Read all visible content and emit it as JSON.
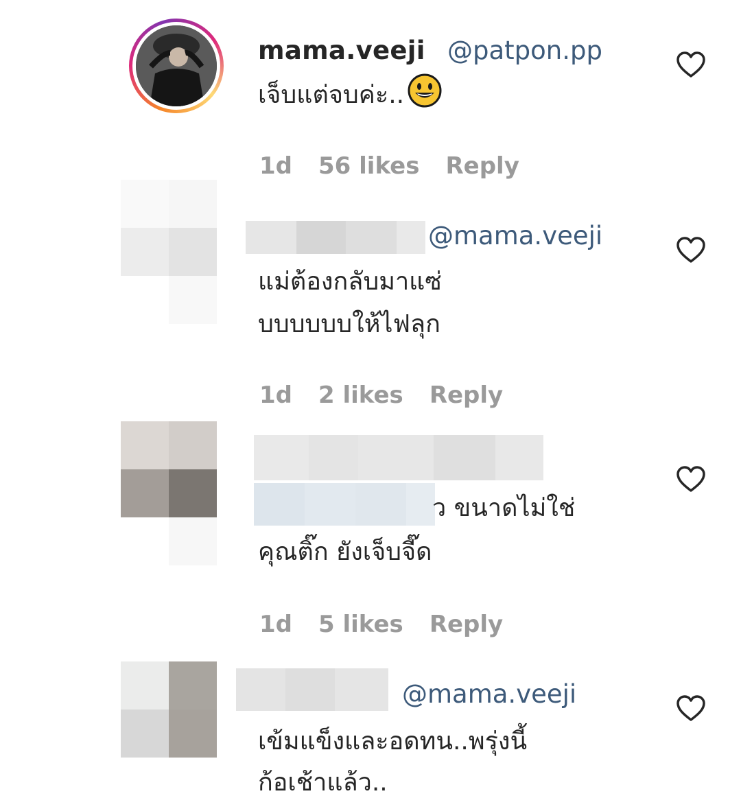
{
  "comments": [
    {
      "username": "mama.veeji",
      "mention": "@patpon.pp",
      "text_lines": [
        "เจ็บแต่จบค่ะ.."
      ],
      "emoji": "grinning-face-emoji",
      "time": "1d",
      "likes": "56 likes",
      "reply": "Reply"
    },
    {
      "username": "",
      "mention": "@mama.veeji",
      "text_lines": [
        "แม่ต้องกลับมาแซ่",
        "บบบบบบให้ไฟลุก"
      ],
      "time": "1d",
      "likes": "2 likes",
      "reply": "Reply"
    },
    {
      "username": "",
      "mention": "",
      "text_lines": [
        "ว ขนาดไม่ใช่",
        "คุณติ๊ก ยังเจ็บจี๊ด"
      ],
      "time": "1d",
      "likes": "5 likes",
      "reply": "Reply"
    },
    {
      "username": "",
      "mention": "@mama.veeji",
      "text_lines": [
        "เข้มแข็งและอดทน..พรุ่งนี้",
        "ก้อเช้าแล้ว.."
      ]
    }
  ],
  "icons": {
    "like": "heart-outline-icon",
    "avatar_ring": "story-ring"
  },
  "colors": {
    "mention": "#3d5a7a",
    "meta": "#9a9a9a",
    "text": "#262626"
  }
}
